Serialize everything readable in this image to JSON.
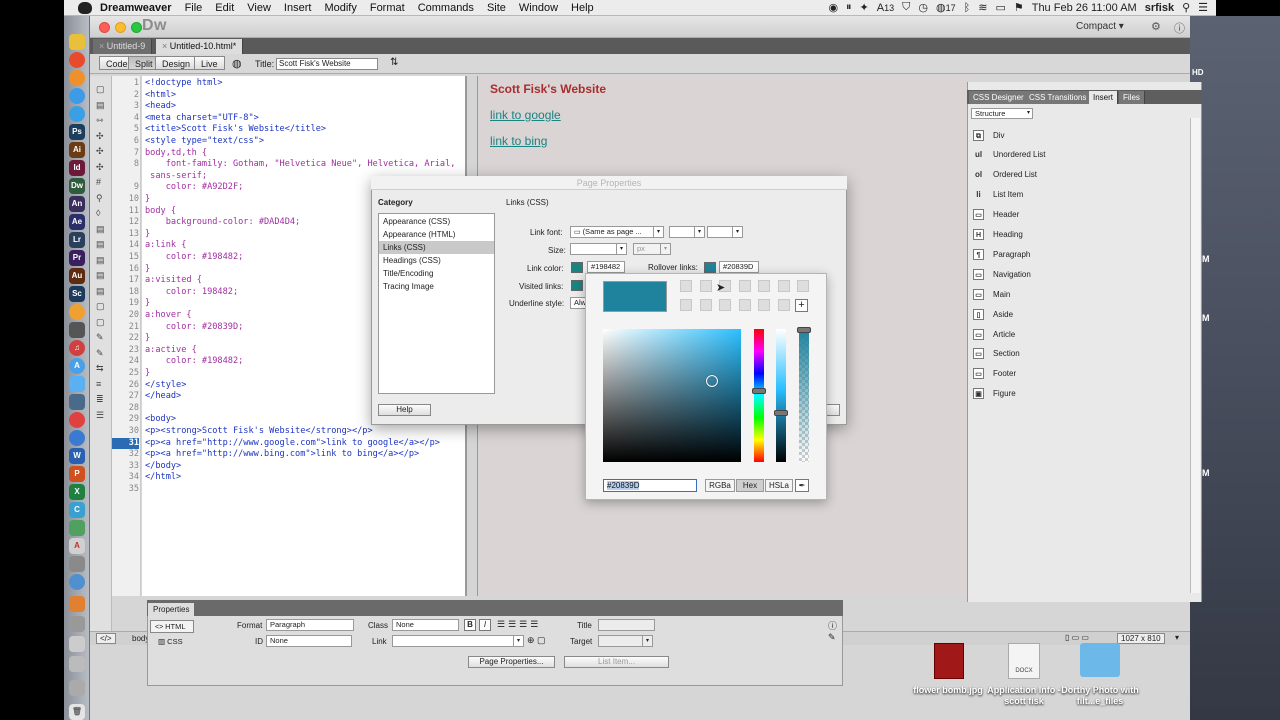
{
  "menubar": {
    "app_name": "Dreamweaver",
    "items": [
      "File",
      "Edit",
      "View",
      "Insert",
      "Modify",
      "Format",
      "Commands",
      "Site",
      "Window",
      "Help"
    ],
    "status_num1": "13",
    "status_num2": "17",
    "clock": "Thu Feb 26  11:00 AM",
    "user": "srfisk"
  },
  "window": {
    "logo": "Dw",
    "workspace": "Compact"
  },
  "tabs": [
    {
      "label": "Untitled-9"
    },
    {
      "label": "Untitled-10.html*"
    }
  ],
  "toolbar": {
    "code": "Code",
    "split": "Split",
    "design": "Design",
    "live": "Live",
    "title_label": "Title:",
    "title_value": "Scott Fisk's Website"
  },
  "code": {
    "line_numbers": [
      "1",
      "2",
      "3",
      "4",
      "5",
      "6",
      "7",
      "8",
      "",
      "9",
      "10",
      "11",
      "12",
      "13",
      "14",
      "15",
      "16",
      "17",
      "18",
      "19",
      "20",
      "21",
      "22",
      "23",
      "24",
      "25",
      "26",
      "27",
      "28",
      "29",
      "30",
      "31",
      "32",
      "33",
      "34",
      "35"
    ],
    "current_line": "31",
    "lines": [
      "<!doctype html>",
      "<html>",
      "<head>",
      "<meta charset=\"UTF-8\">",
      "<title>Scott Fisk's Website</title>",
      "<style type=\"text/css\">",
      "body,td,th {",
      "    font-family: Gotham, \"Helvetica Neue\", Helvetica, Arial,",
      " sans-serif;",
      "    color: #A92D2F;",
      "}",
      "body {",
      "    background-color: #DAD4D4;",
      "}",
      "a:link {",
      "    color: #198482;",
      "}",
      "a:visited {",
      "    color: 198482;",
      "}",
      "a:hover {",
      "    color: #20839D;",
      "}",
      "a:active {",
      "    color: #198482;",
      "}",
      "</style>",
      "</head>",
      "",
      "<body>",
      "<p><strong>Scott Fisk's Website</strong></p>",
      "<p><a href=\"http://www.google.com\">link to google</a></p>",
      "<p><a href=\"http://www.bing.com\">link to bing</a></p>",
      "</body>",
      "</html>",
      ""
    ]
  },
  "design": {
    "heading": "Scott Fisk's Website",
    "link1": "link to google",
    "link2": "link to bing"
  },
  "right_panel": {
    "tabs": [
      "CSS Designer",
      "CSS Transitions",
      "Insert",
      "Files"
    ],
    "category": "Structure",
    "items": [
      {
        "label": "Div",
        "icon": "div-icon",
        "glyph": "⧉"
      },
      {
        "label": "Unordered List",
        "icon": "unordered-list-icon",
        "glyph": "ul"
      },
      {
        "label": "Ordered List",
        "icon": "ordered-list-icon",
        "glyph": "ol"
      },
      {
        "label": "List Item",
        "icon": "list-item-icon",
        "glyph": "li"
      },
      {
        "label": "Header",
        "icon": "header-icon",
        "glyph": "▭"
      },
      {
        "label": "Heading",
        "icon": "heading-icon",
        "glyph": "H"
      },
      {
        "label": "Paragraph",
        "icon": "paragraph-icon",
        "glyph": "¶"
      },
      {
        "label": "Navigation",
        "icon": "navigation-icon",
        "glyph": "▭"
      },
      {
        "label": "Main",
        "icon": "main-icon",
        "glyph": "▭"
      },
      {
        "label": "Aside",
        "icon": "aside-icon",
        "glyph": "▯"
      },
      {
        "label": "Article",
        "icon": "article-icon",
        "glyph": "▭"
      },
      {
        "label": "Section",
        "icon": "section-icon",
        "glyph": "▭"
      },
      {
        "label": "Footer",
        "icon": "footer-icon",
        "glyph": "▭"
      },
      {
        "label": "Figure",
        "icon": "figure-icon",
        "glyph": "▣"
      }
    ]
  },
  "dialog": {
    "title": "Page Properties",
    "category_label": "Category",
    "categories": [
      "Appearance (CSS)",
      "Appearance (HTML)",
      "Links (CSS)",
      "Headings (CSS)",
      "Title/Encoding",
      "Tracing Image"
    ],
    "selected_category": "Links (CSS)",
    "section_title": "Links (CSS)",
    "link_font_label": "Link font:",
    "link_font_value": "(Same as page ...",
    "size_label": "Size:",
    "size_unit": "px",
    "link_color_label": "Link color:",
    "link_color_value": "#198482",
    "rollover_label": "Rollover links:",
    "rollover_value": "#20839D",
    "visited_label": "Visited links:",
    "underline_label": "Underline style:",
    "underline_value": "Alw",
    "help": "Help"
  },
  "picker": {
    "hex_value": "#20839D",
    "modes": [
      "RGBa",
      "Hex",
      "HSLa"
    ],
    "active_mode": "Hex",
    "add": "+"
  },
  "properties": {
    "title": "Properties",
    "html": "HTML",
    "css": "CSS",
    "format_label": "Format",
    "format_value": "Paragraph",
    "class_label": "Class",
    "class_value": "None",
    "id_label": "ID",
    "id_value": "None",
    "link_label": "Link",
    "title_label": "Title",
    "target_label": "Target",
    "page_props": "Page Properties...",
    "list_item": "List Item..."
  },
  "status": {
    "tag": "</>",
    "body": "body",
    "size": "1027 x 810"
  },
  "desktop": {
    "hd": "HD",
    "files": [
      {
        "label": "flower bomb.jpg"
      },
      {
        "label": "Application Info -scott fisk"
      },
      {
        "label": "Dorthy Photo with filt...e_files"
      }
    ],
    "docx": "DOCX"
  },
  "colors": {
    "heading": "#A92D2F",
    "link": "#198482",
    "rollover": "#20839D",
    "background": "#DAD4D4"
  }
}
